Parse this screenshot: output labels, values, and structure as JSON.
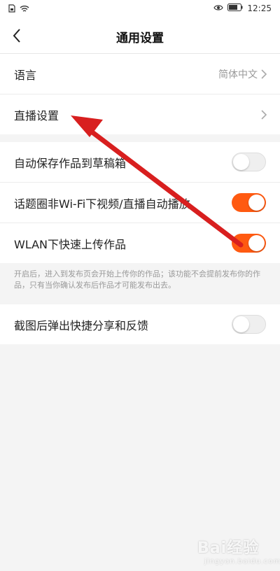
{
  "status_bar": {
    "time": "12:25"
  },
  "header": {
    "title": "通用设置"
  },
  "section1": {
    "rows": [
      {
        "label": "语言",
        "value": "简体中文"
      },
      {
        "label": "直播设置"
      }
    ]
  },
  "section2": {
    "rows": [
      {
        "label": "自动保存作品到草稿箱",
        "toggle": "off"
      },
      {
        "label": "话题圈非Wi-Fi下视频/直播自动播放",
        "toggle": "on"
      },
      {
        "label": "WLAN下快速上传作品",
        "toggle": "on"
      }
    ],
    "note": "开启后，进入到发布页会开始上传你的作品；该功能不会提前发布你的作品，只有当你确认发布后作品才可能发布出去。"
  },
  "section3": {
    "rows": [
      {
        "label": "截图后弹出快捷分享和反馈",
        "toggle": "off"
      }
    ]
  },
  "watermark": {
    "main": "Bai经验",
    "sub": "jingyan.baidu.com"
  },
  "colors": {
    "accent": "#ff5a11",
    "annotation_arrow": "#e32020",
    "background": "#f4f4f4"
  }
}
